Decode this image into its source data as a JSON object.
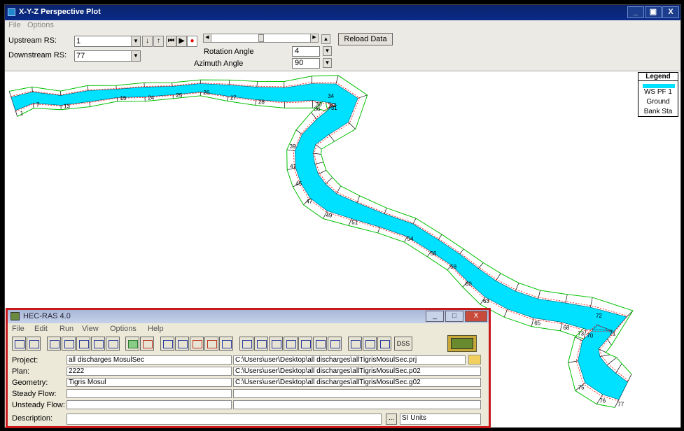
{
  "plot_window": {
    "title": "X-Y-Z Perspective Plot",
    "menu": [
      "File",
      "Options"
    ],
    "upstream_label": "Upstream RS:",
    "upstream_value": "1",
    "downstream_label": "Downstream RS:",
    "downstream_value": "77",
    "rotation_label": "Rotation Angle",
    "rotation_value": "4",
    "azimuth_label": "Azimuth Angle",
    "azimuth_value": "90",
    "reload_label": "Reload Data",
    "title_buttons": [
      "_",
      "▣",
      "X"
    ]
  },
  "legend": {
    "title": "Legend",
    "items": [
      "WS PF 1",
      "Ground",
      "Bank Sta"
    ],
    "colors": {
      "ws": "#00e0ff",
      "ground": "#00c000",
      "bank": "#ff0000",
      "section": "#000000"
    }
  },
  "station_labels": [
    {
      "t": "1"
    },
    {
      "t": "7"
    },
    {
      "t": "13"
    },
    {
      "t": "15"
    },
    {
      "t": "24"
    },
    {
      "t": "25"
    },
    {
      "t": "26"
    },
    {
      "t": "27"
    },
    {
      "t": "28"
    },
    {
      "t": "30"
    },
    {
      "t": "31"
    },
    {
      "t": "32"
    },
    {
      "t": "34"
    },
    {
      "t": "36"
    },
    {
      "t": "39"
    },
    {
      "t": "41"
    },
    {
      "t": "45"
    },
    {
      "t": "47"
    },
    {
      "t": "49"
    },
    {
      "t": "51"
    },
    {
      "t": "54"
    },
    {
      "t": "56"
    },
    {
      "t": "58"
    },
    {
      "t": "60"
    },
    {
      "t": "63"
    },
    {
      "t": "65"
    },
    {
      "t": "68"
    },
    {
      "t": "70"
    },
    {
      "t": "71"
    },
    {
      "t": "72"
    },
    {
      "t": "73"
    },
    {
      "t": "75"
    },
    {
      "t": "76"
    },
    {
      "t": "77"
    }
  ],
  "hec": {
    "title": "HEC-RAS 4.0",
    "menu": [
      "File",
      "Edit",
      "Run",
      "View",
      "Options",
      "Help"
    ],
    "title_buttons": [
      "_",
      "□",
      "X"
    ],
    "project_label": "Project:",
    "project_name": "all discharges MosulSec",
    "project_path": "C:\\Users\\user\\Desktop\\all discharges\\allTigrisMosulSec.prj",
    "plan_label": "Plan:",
    "plan_name": "2222",
    "plan_path": "C:\\Users\\user\\Desktop\\all discharges\\allTigrisMosulSec.p02",
    "geometry_label": "Geometry:",
    "geometry_name": "Tigris Mosul",
    "geometry_path": "C:\\Users\\user\\Desktop\\all discharges\\allTigrisMosulSec.g02",
    "steady_label": "Steady Flow:",
    "unsteady_label": "Unsteady Flow:",
    "description_label": "Description:",
    "si_units": "SI Units",
    "dss_label": "DSS"
  }
}
